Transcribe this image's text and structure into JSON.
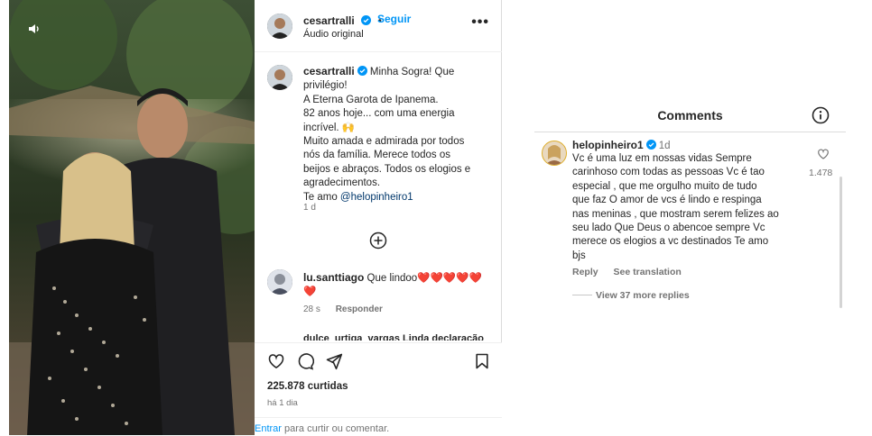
{
  "post": {
    "header": {
      "username": "cesartralli",
      "follow_label": "Seguir",
      "subtitle": "Áudio original",
      "more_label": "•••"
    },
    "caption": {
      "username": "cesartralli",
      "lines": [
        "Minha Sogra! Que",
        "privilégio!",
        "A Eterna Garota de Ipanema.",
        "82 anos hoje... com uma energia",
        "incrível. 🙌",
        "Muito amada e admirada por todos",
        "nós da família. Merece todos os",
        "beijos e abraços. Todos os elogios e",
        "agradecimentos."
      ],
      "closing": "Te amo",
      "mention": "@helopinheiro1",
      "time": "1 d"
    },
    "comments": [
      {
        "username": "lu.santtiago",
        "text": "Que lindoo",
        "hearts": "❤️❤️❤️❤️❤️",
        "hearts_line2": "❤️",
        "time": "28 s",
        "reply_label": "Responder"
      },
      {
        "text": "dulce_urtiga_vargas Linda declaração!"
      }
    ],
    "likes": "225.878 curtidas",
    "posted_ago": "há 1 dia",
    "login": {
      "link": "Entrar",
      "text": " para curtir ou comentar."
    }
  },
  "comments_panel": {
    "title": "Comments",
    "comment": {
      "username": "helopinheiro1",
      "time": "1d",
      "lines": [
        "Vc é uma luz em nossas vidas Sempre",
        "carinhoso com todas as pessoas Vc é tao",
        "especial , que me orgulho muito de tudo",
        "que faz O amor de vcs é lindo e respinga",
        "nas meninas , que mostram serem felizes ao",
        "seu lado Que Deus o abencoe sempre Vc",
        "merece os elogios a vc destinados Te amo",
        "bjs"
      ],
      "like_count": "1.478",
      "reply_label": "Reply",
      "translate_label": "See translation",
      "view_replies": "View 37 more replies"
    }
  },
  "colors": {
    "link_blue": "#0095f6",
    "mention_blue": "#00376b",
    "verified_blue": "#0095f6",
    "muted": "#737373"
  },
  "icons": [
    "audio-icon",
    "verified-icon",
    "more-icon",
    "plus-circle-icon",
    "like-icon",
    "comment-icon",
    "share-icon",
    "save-icon",
    "info-icon",
    "heart-outline-icon"
  ]
}
